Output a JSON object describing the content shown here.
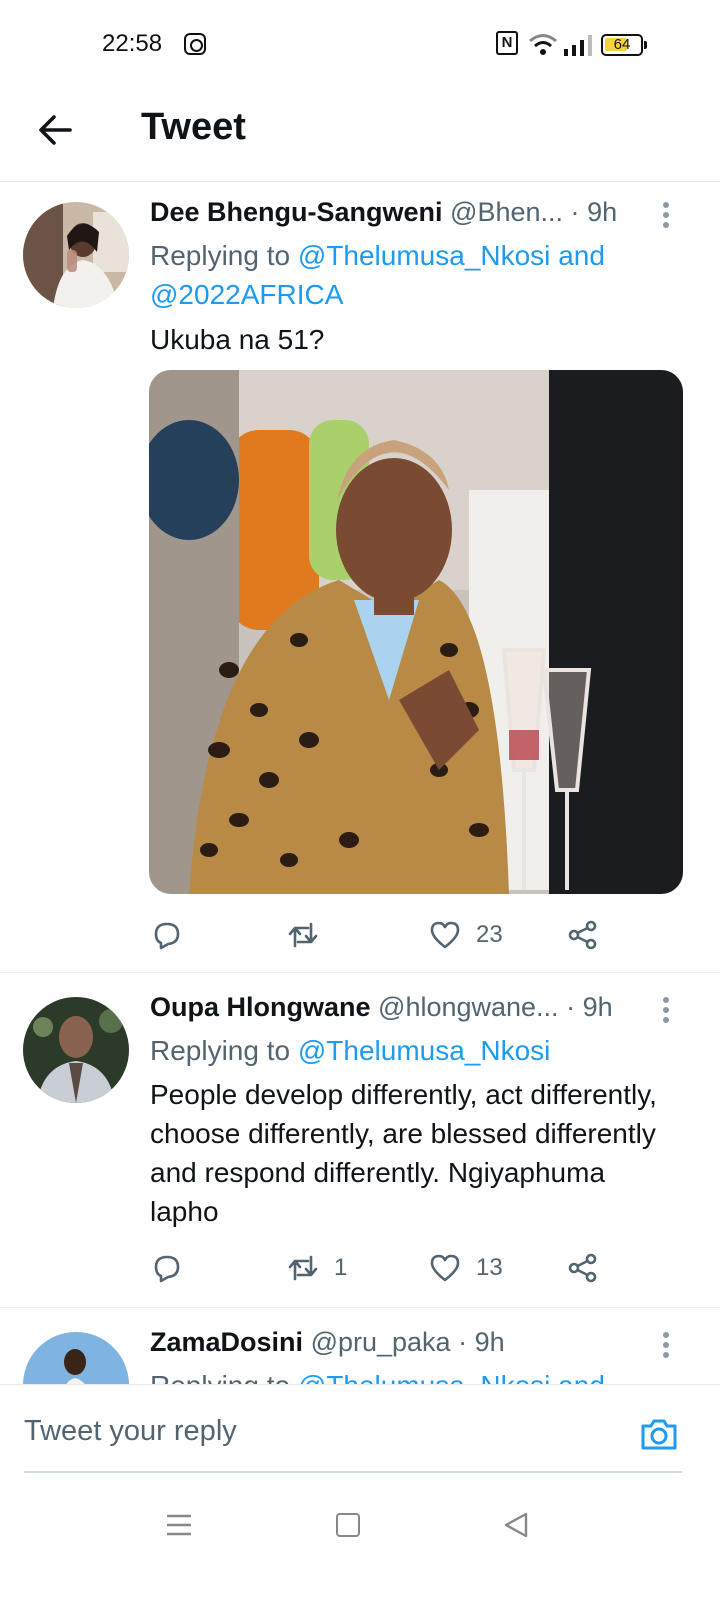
{
  "status_bar": {
    "time": "22:58",
    "battery": "64",
    "battery_level": 0.64,
    "icons": [
      "instagram-icon",
      "nfc-icon",
      "wifi-icon",
      "signal-icon",
      "battery-icon"
    ]
  },
  "header": {
    "title": "Tweet",
    "back_icon": "arrow-left-icon"
  },
  "tweets": [
    {
      "author": "Dee Bhengu-Sangweni",
      "handle": "@Bhen...",
      "time": "9h",
      "replying_prefix": "Replying to",
      "replying_to": "@Thelumusa_Nkosi",
      "replying_joiner": "and",
      "replying_to_2": "@2022AFRICA",
      "text": "Ukuba na 51?",
      "has_media": true,
      "replies": "",
      "retweets": "",
      "likes": "23"
    },
    {
      "author": "Oupa Hlongwane",
      "handle": "@hlongwane...",
      "time": "9h",
      "replying_prefix": "Replying to",
      "replying_to": "@Thelumusa_Nkosi",
      "text": "People develop differently, act differently, choose differently, are blessed differently and respond differently. Ngiyaphuma lapho",
      "replies": "",
      "retweets": "1",
      "likes": "13"
    },
    {
      "author": "ZamaDosini",
      "handle": "@pru_paka",
      "time": "9h",
      "replying_prefix": "Replying to",
      "replying_to": "@Thelumusa_Nkosi and"
    }
  ],
  "separator": "·",
  "reply_bar": {
    "placeholder": "Tweet your reply"
  },
  "colors": {
    "accent": "#1d9bf0",
    "text": "#0f1419",
    "secondary": "#536471"
  }
}
